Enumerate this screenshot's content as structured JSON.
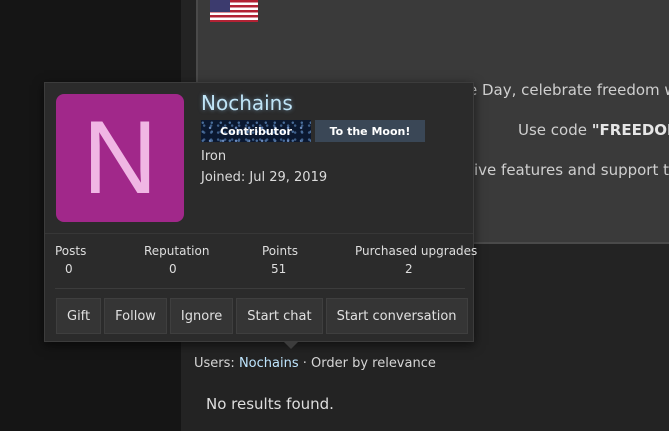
{
  "background_notice": {
    "line1": "e Day, celebrate freedom w",
    "line2_prefix": "Use code ",
    "line2_code": "\"FREEDOM",
    "line3": "ive features and support th"
  },
  "search": {
    "users_label": "Users:",
    "users_value": "Nochains",
    "order_text": " · Order by relevance",
    "no_results": "No results found."
  },
  "profile": {
    "avatar_letter": "N",
    "username": "Nochains",
    "banners": [
      "Contributor",
      "To the Moon!"
    ],
    "user_title": "Iron",
    "joined": "Joined: Jul 29, 2019",
    "stats": [
      {
        "label": "Posts",
        "value": "0"
      },
      {
        "label": "Reputation",
        "value": "0"
      },
      {
        "label": "Points",
        "value": "51"
      },
      {
        "label": "Purchased upgrades",
        "value": "2"
      }
    ],
    "actions": [
      "Gift",
      "Follow",
      "Ignore",
      "Start chat",
      "Start conversation"
    ]
  },
  "colors": {
    "avatar_bg": "#a1288a",
    "avatar_letter": "#f0b6e4",
    "username": "#bfe4f6",
    "link": "#bfe6ff"
  }
}
